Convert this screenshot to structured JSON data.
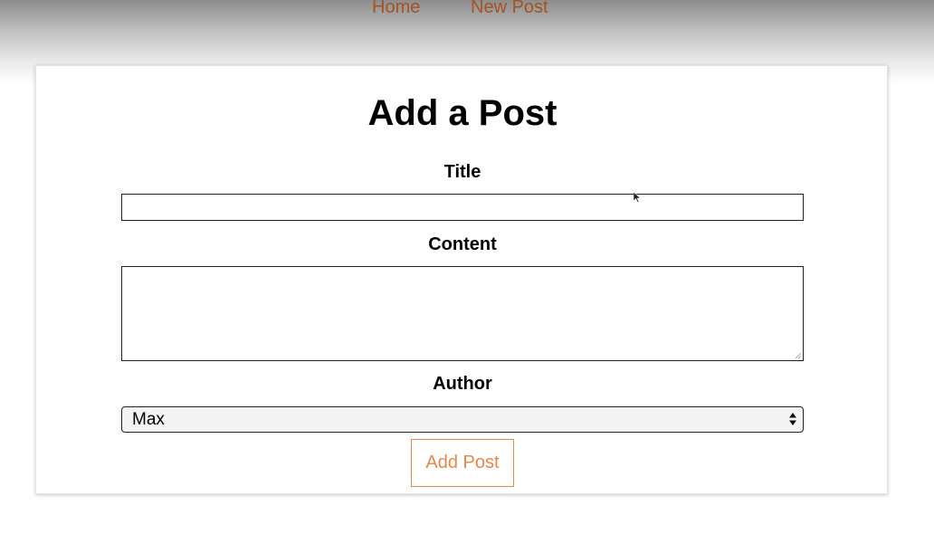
{
  "nav": {
    "home_label": "Home",
    "new_post_label": "New Post",
    "link_color": "#a6531f"
  },
  "form": {
    "heading": "Add a Post",
    "title_label": "Title",
    "title_value": "",
    "content_label": "Content",
    "content_value": "",
    "author_label": "Author",
    "author_selected": "Max",
    "submit_label": "Add Post",
    "accent_color": "#e8874a"
  },
  "icons": {
    "select_arrows": "updown-arrows-icon",
    "resize": "resize-grip-icon",
    "pointer": "mouse-cursor-icon"
  }
}
